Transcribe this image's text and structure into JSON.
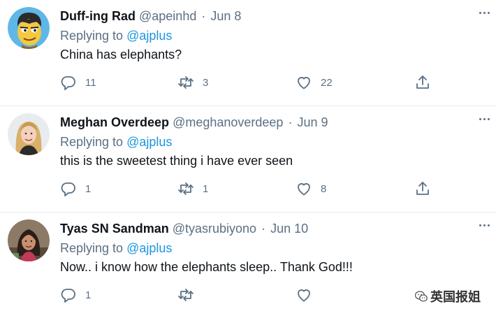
{
  "tweets": [
    {
      "name": "Duff-ing Rad",
      "handle": "@apeinhd",
      "sep": "·",
      "date": "Jun 8",
      "replying_prefix": "Replying to",
      "replying_to": "@ajplus",
      "text": "China has elephants?",
      "reply_count": "11",
      "retweet_count": "3",
      "like_count": "22",
      "avatar_icon": "cartoon-face-avatar"
    },
    {
      "name": "Meghan Overdeep",
      "handle": "@meghanoverdeep",
      "sep": "·",
      "date": "Jun 9",
      "replying_prefix": "Replying to",
      "replying_to": "@ajplus",
      "text": "this is the sweetest thing i have ever seen",
      "reply_count": "1",
      "retweet_count": "1",
      "like_count": "8",
      "avatar_icon": "photo-avatar"
    },
    {
      "name": "Tyas SN Sandman",
      "handle": "@tyasrubiyono",
      "sep": "·",
      "date": "Jun 10",
      "replying_prefix": "Replying to",
      "replying_to": "@ajplus",
      "text": "Now.. i know how the elephants sleep.. Thank God!!!",
      "reply_count": "1",
      "retweet_count": "",
      "like_count": "",
      "avatar_icon": "photo-avatar"
    }
  ],
  "watermark": {
    "text": "英国报姐",
    "icon": "wechat-logo"
  },
  "colors": {
    "link": "#1b95e0",
    "secondary": "#5b7083",
    "text": "#0f1419",
    "divider": "#e6ecf0"
  }
}
